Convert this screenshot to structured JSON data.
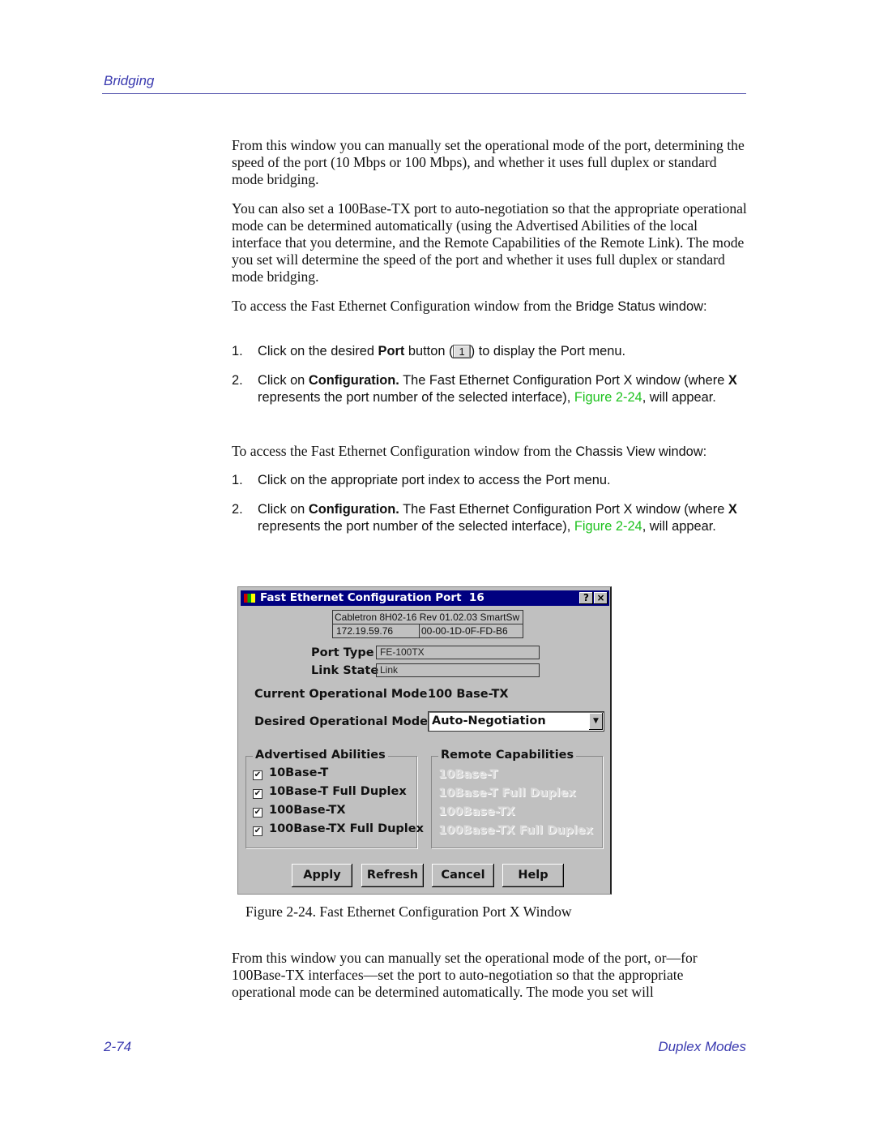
{
  "header": {
    "section": "Bridging"
  },
  "intro": [
    "From this window you can manually set the operational mode of the port, determining the speed of the port (10 Mbps or 100 Mbps), and whether it uses full duplex or standard mode bridging.",
    "You can also set a 100Base-TX port to auto-negotiation so that the appropriate operational mode can be determined automatically (using the Advertised Abilities of the local interface that you determine, and the Remote Capabilities of the Remote Link). The mode you set will determine the speed of the port and whether it uses full duplex or standard mode bridging."
  ],
  "access1": {
    "lead_serif": "To access the Fast Ethernet Configuration window from the ",
    "lead_sans": "Bridge Status window:",
    "step1": {
      "num": "1.",
      "a": "Click on the desired ",
      "b": "Port",
      "c": " button (",
      "btn": "1",
      "d": ") to display the Port menu."
    },
    "step2": {
      "num": "2.",
      "a": "Click on ",
      "b": "Configuration.",
      "c": " The Fast Ethernet Configuration Port X window (where ",
      "x": "X",
      "d": " represents the port number of the selected interface), ",
      "link": "Figure 2-24",
      ",": ",",
      "e": " will appear."
    }
  },
  "access2": {
    "lead_serif": "To access the Fast Ethernet Configuration window from the ",
    "lead_sans": "Chassis View window:",
    "step1": {
      "num": "1.",
      "text": "Click on the appropriate port index to access the Port menu."
    },
    "step2": {
      "num": "2.",
      "a": "Click on ",
      "b": "Configuration.",
      "c": " The Fast Ethernet Configuration Port X window (where ",
      "x": "X",
      "d": " represents the port number of the selected interface), ",
      "link": "Figure 2-24",
      "e": " will appear."
    }
  },
  "dialog": {
    "title": "Fast Ethernet Configuration Port  16",
    "help": "?",
    "close": "×",
    "device": "Cabletron 8H02-16 Rev 01.02.03 SmartSw",
    "ip": "172.19.59.76",
    "mac": "00-00-1D-0F-FD-B6",
    "port_type_label": "Port Type",
    "port_type": "FE-100TX",
    "link_state_label": "Link State",
    "link_state": "Link",
    "current_mode_label": "Current Operational Mode",
    "current_mode": "100 Base-TX",
    "desired_mode_label": "Desired Operational Mode",
    "desired_mode": "Auto-Negotiation",
    "advertised_title": "Advertised Abilities",
    "advertised": [
      {
        "label": "10Base-T",
        "checked": true
      },
      {
        "label": "10Base-T Full Duplex",
        "checked": true
      },
      {
        "label": "100Base-TX",
        "checked": true
      },
      {
        "label": "100Base-TX Full Duplex",
        "checked": true
      }
    ],
    "remote_title": "Remote Capabilities",
    "remote": [
      "10Base-T",
      "10Base-T Full Duplex",
      "100Base-TX",
      "100Base-TX Full Duplex"
    ],
    "buttons": {
      "apply": "Apply",
      "refresh": "Refresh",
      "cancel": "Cancel",
      "help": "Help"
    }
  },
  "caption": "Figure 2-24.  Fast Ethernet Configuration Port X Window",
  "outro": "From this window you can manually set the operational mode of the port, or—for 100Base-TX interfaces—set the port to auto-negotiation so that the appropriate operational mode can be determined automatically. The mode you set will",
  "footer": {
    "page": "2-74",
    "section": "Duplex Modes"
  }
}
